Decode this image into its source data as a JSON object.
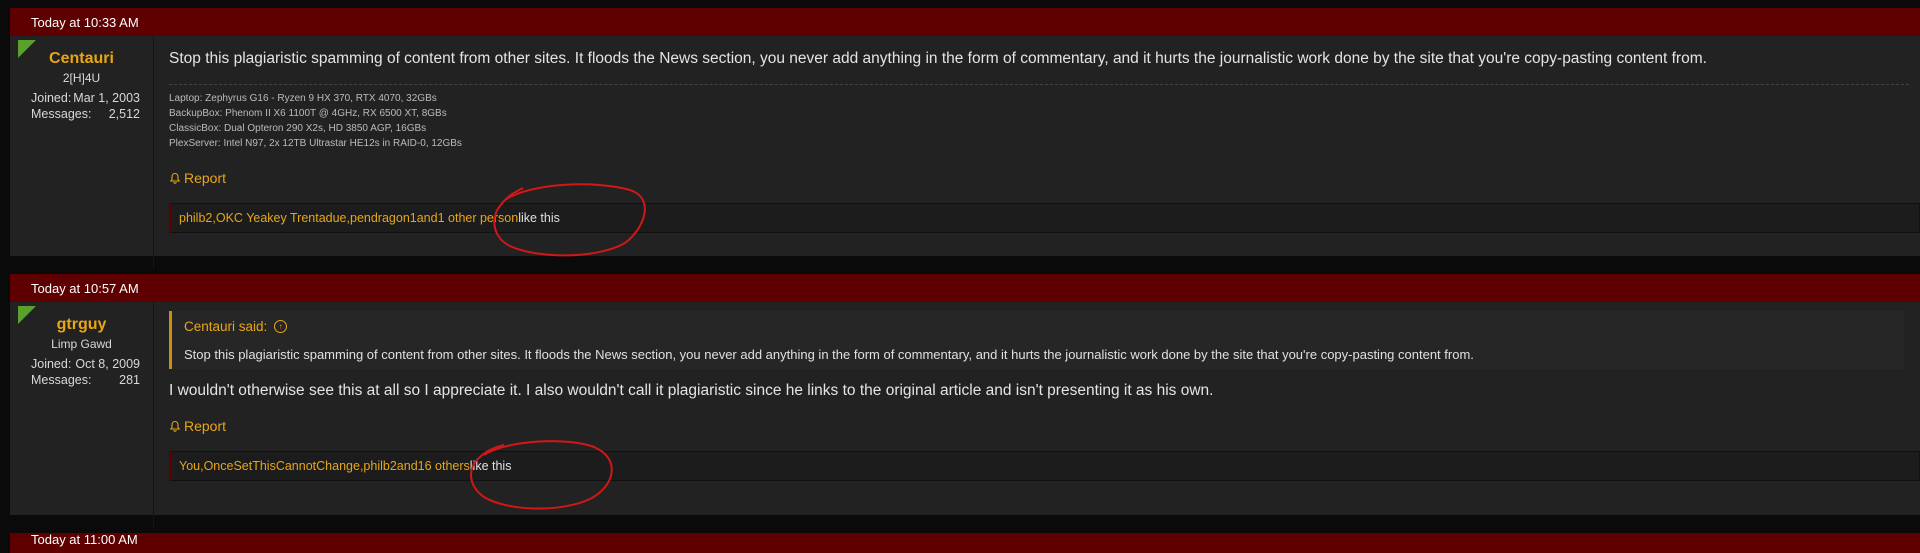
{
  "posts": [
    {
      "timestamp": "Today at 10:33 AM",
      "username": "Centauri",
      "usertitle": "2[H]4U",
      "joined_label": "Joined:",
      "joined_value": "Mar 1, 2003",
      "messages_label": "Messages:",
      "messages_value": "2,512",
      "message": "Stop this plagiaristic spamming of content from other sites. It floods the News section, you never add anything in the form of commentary, and it hurts the journalistic work done by the site that you're copy-pasting content from.",
      "signature": [
        "Laptop: Zephyrus G16 - Ryzen 9 HX 370, RTX 4070, 32GBs",
        "BackupBox: Phenom II X6 1100T @ 4GHz, RX 6500 XT, 8GBs",
        "ClassicBox: Dual Opteron 290 X2s, HD 3850 AGP, 16GBs",
        "PlexServer: Intel N97, 2x 12TB Ultrastar HE12s in RAID-0, 12GBs"
      ],
      "report_label": "Report",
      "likes": {
        "users": [
          "philb2",
          "OKC Yeakey Trentadue",
          "pendragon1"
        ],
        "sep": ", ",
        "and": " and ",
        "others": "1 other person",
        "suffix": " like this"
      }
    },
    {
      "timestamp": "Today at 10:57 AM",
      "username": "gtrguy",
      "usertitle": "Limp Gawd",
      "joined_label": "Joined:",
      "joined_value": "Oct 8, 2009",
      "messages_label": "Messages:",
      "messages_value": "281",
      "quote": {
        "author": "Centauri said:",
        "text": "Stop this plagiaristic spamming of content from other sites. It floods the News section, you never add anything in the form of commentary, and it hurts the journalistic work done by the site that you're copy-pasting content from."
      },
      "message": "I wouldn't otherwise see this at all so I appreciate it. I also wouldn't call it plagiaristic since he links to the original article and isn't presenting it as his own.",
      "report_label": "Report",
      "likes": {
        "users": [
          "You",
          "OnceSetThisCannotChange",
          "philb2"
        ],
        "sep": ", ",
        "and": " and ",
        "others": "16 others",
        "suffix": " like this"
      }
    }
  ],
  "next_post_timestamp": "Today at 11:00 AM",
  "colors": {
    "header": "#5e0000",
    "accent": "#e8a617",
    "corner": "#5aa02c",
    "annotation": "#d01818"
  }
}
